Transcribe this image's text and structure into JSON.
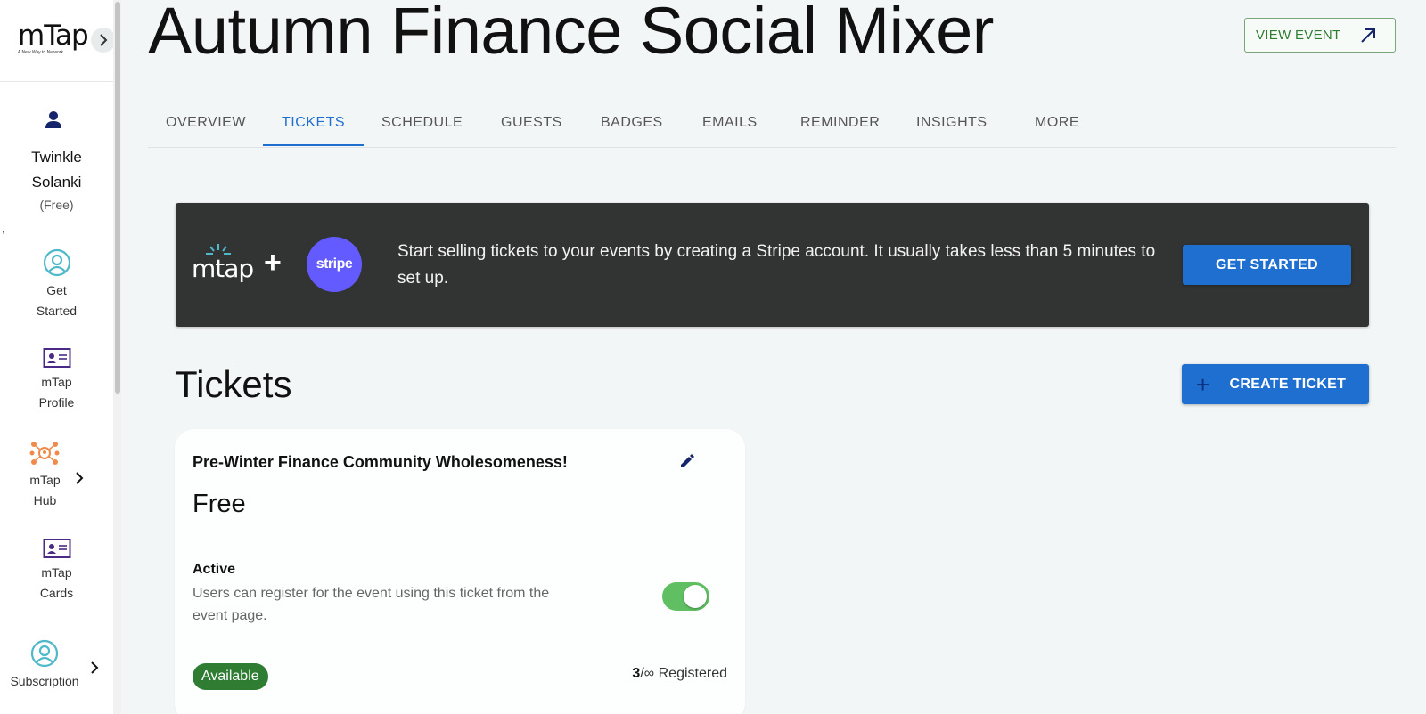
{
  "sidebar": {
    "logo_text": "mTap",
    "logo_tagline": "A New Way to Network",
    "user": {
      "first_name": "Twinkle",
      "last_name": "Solanki",
      "plan": "(Free)"
    },
    "stray_text": ",",
    "items": [
      {
        "line1": "Get",
        "line2": "Started",
        "icon": "person-circle-icon"
      },
      {
        "line1": "mTap",
        "line2": "Profile",
        "icon": "id-card-icon"
      },
      {
        "line1": "mTap",
        "line2": "Hub",
        "icon": "hub-network-icon"
      },
      {
        "line1": "mTap",
        "line2": "Cards",
        "icon": "id-card-icon"
      },
      {
        "line1": "Subscription",
        "line2": "",
        "icon": "person-circle-icon"
      }
    ]
  },
  "header": {
    "title": "Autumn Finance Social Mixer",
    "view_event_label": "VIEW EVENT"
  },
  "tabs": [
    {
      "label": "OVERVIEW",
      "active": false
    },
    {
      "label": "TICKETS",
      "active": true
    },
    {
      "label": "SCHEDULE",
      "active": false
    },
    {
      "label": "GUESTS",
      "active": false
    },
    {
      "label": "BADGES",
      "active": false
    },
    {
      "label": "EMAILS",
      "active": false
    },
    {
      "label": "REMINDER",
      "active": false
    },
    {
      "label": "INSIGHTS",
      "active": false
    },
    {
      "label": "MORE",
      "active": false
    }
  ],
  "banner": {
    "mtap_logo": "mtap",
    "plus": "+",
    "stripe_logo": "stripe",
    "message": "Start selling tickets to your events by creating a Stripe account. It usually takes less than 5 minutes to set up.",
    "button_label": "GET STARTED"
  },
  "tickets_section": {
    "heading": "Tickets",
    "create_button_label": "CREATE TICKET",
    "create_button_icon": "+"
  },
  "ticket": {
    "name": "Pre-Winter Finance Community Wholesomeness!",
    "price": "Free",
    "status_label": "Active",
    "status_description": "Users can register for the event using this ticket from the event page.",
    "active_toggle_on": true,
    "availability": "Available",
    "registered_count": "3",
    "registered_capacity": "/∞",
    "registered_label": " Registered"
  },
  "colors": {
    "accent_blue": "#1e6fd0",
    "banner_bg": "#323333",
    "stripe_purple": "#635bff",
    "success_green": "#2e7d32",
    "toggle_green": "#5fbf62",
    "page_bg": "#f3f6f7"
  }
}
